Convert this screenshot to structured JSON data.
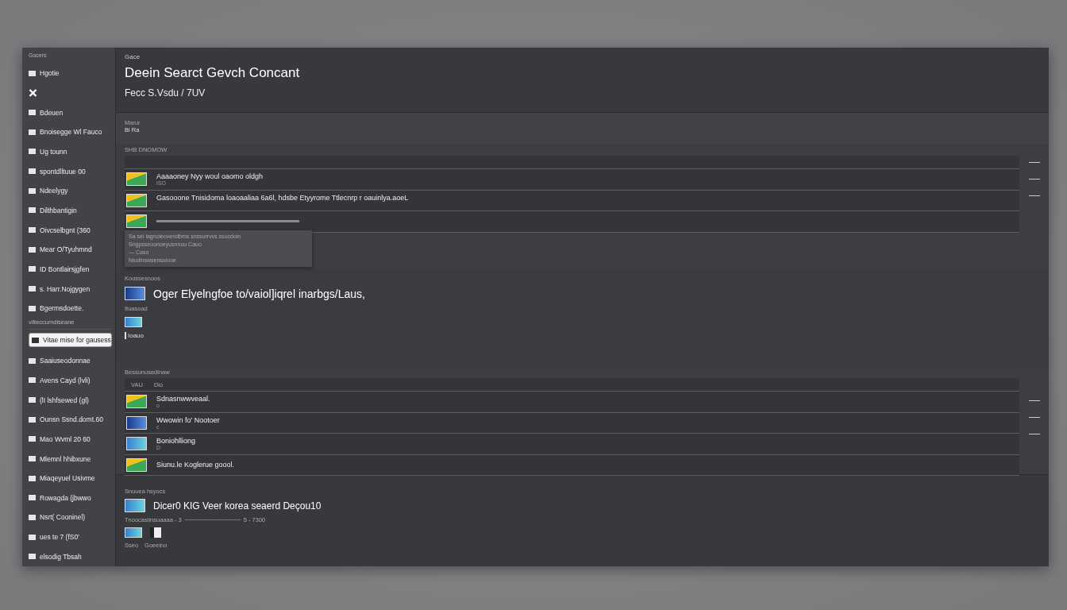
{
  "sidebar": {
    "header": "Gocers",
    "items": [
      {
        "kind": "item",
        "label": "Hgotie",
        "selected": false
      },
      {
        "kind": "icon-only",
        "selected": false
      },
      {
        "kind": "item",
        "label": "Bdeuen",
        "selected": false
      },
      {
        "kind": "item",
        "label": "Bnoisegge Wl Fauco",
        "selected": false
      },
      {
        "kind": "item",
        "label": "Ug tounn",
        "selected": false
      },
      {
        "kind": "item",
        "label": "spontdlltuue 00",
        "selected": false
      },
      {
        "kind": "item",
        "label": "Ndeelygy",
        "selected": false
      },
      {
        "kind": "item",
        "label": "Dilthbantigin",
        "selected": false
      },
      {
        "kind": "item",
        "label": "Oivcselbgnt (360",
        "selected": false
      },
      {
        "kind": "item",
        "label": "Mear O/Tyuhmnd",
        "selected": false
      },
      {
        "kind": "item",
        "label": "ID Bontlairsjgfen",
        "selected": false
      },
      {
        "kind": "item",
        "label": "s. Harr.Nojgygen",
        "selected": false
      },
      {
        "kind": "item",
        "label": "Bgermsdoette.",
        "selected": false
      },
      {
        "kind": "divider",
        "label": "vilteccumdiseane"
      },
      {
        "kind": "item",
        "label": "Vitae mise for gausess",
        "selected": true
      },
      {
        "kind": "item",
        "label": "Saaiuseodonnae",
        "selected": false
      },
      {
        "kind": "item",
        "label": "Avens Cayd (lvli)",
        "selected": false
      },
      {
        "kind": "item",
        "label": "(lI lshfsewed (gl)",
        "selected": false
      },
      {
        "kind": "item",
        "label": "Ounsn Ssnd.domt.60",
        "selected": false
      },
      {
        "kind": "item",
        "label": "Mao Wvml 20 60",
        "selected": false
      },
      {
        "kind": "item",
        "label": "Mlemnl hhibxune",
        "selected": false
      },
      {
        "kind": "item",
        "label": "Miaqeyuel Usivme",
        "selected": false
      },
      {
        "kind": "item",
        "label": "Rowagda (jbwwo",
        "selected": false
      },
      {
        "kind": "item",
        "label": "Nsrt( Cooninel)",
        "selected": false
      },
      {
        "kind": "item",
        "label": "ues te 7 (fS0'",
        "selected": false
      },
      {
        "kind": "item",
        "label": "elsodig Tbsah",
        "selected": false
      }
    ]
  },
  "header": {
    "eyebrow": "Gace",
    "title": "Deein Searct Gevch Concant",
    "subtitle": "Fecc S.Vsdu / 7UV"
  },
  "filter": {
    "label": "Marur",
    "value": "Bi Ra"
  },
  "section_a": {
    "title": "SHB DNOMOW",
    "rows": [
      {
        "title": "Aaaaoney Nyy woul oaomo oldgh",
        "meta": "ISO"
      },
      {
        "title": "Gasooone Tnisidoma loaoaaliaa 6a6l, hdsbe Etyyrome Ttlecnrp r oauinlya.aoeL",
        "meta": "·"
      },
      {
        "title": "",
        "meta": ""
      }
    ],
    "popup": [
      "Sa sel lagnoleovendbms snssurrvvs ssucdoin",
      "Sngpsseuonoeyusnnuu Cauo",
      "— Caso",
      "Nsuilnswsensuiooe"
    ]
  },
  "section_b": {
    "title": "Koossesnoos",
    "heading": "Oger Elyelngfoe to/vaiol]iqrel inarbgs/Laus,",
    "note": "Ituasoad",
    "tag": "Ioauo"
  },
  "section_c": {
    "title": "Bessunusedinaw",
    "head": [
      "VAU",
      "Dlo"
    ],
    "rows": [
      {
        "title": "Sdnasnwwveaal.",
        "meta": "o"
      },
      {
        "title": "Wwowin fo' Nootoer",
        "meta": "c"
      },
      {
        "title": "Boniohlliong",
        "meta": "D"
      },
      {
        "title": "Siunu.le Koglerue goool.",
        "meta": ""
      }
    ]
  },
  "section_d": {
    "title": "Snuuea hsyocs",
    "heading": "Dicer0 KIG Veer korea seaerd Deçou10",
    "meta": "Tnoocasiinsuaaaa - 3",
    "meta_end": "5 - 7300",
    "labels": [
      "Sseo",
      "Goeeino"
    ]
  }
}
